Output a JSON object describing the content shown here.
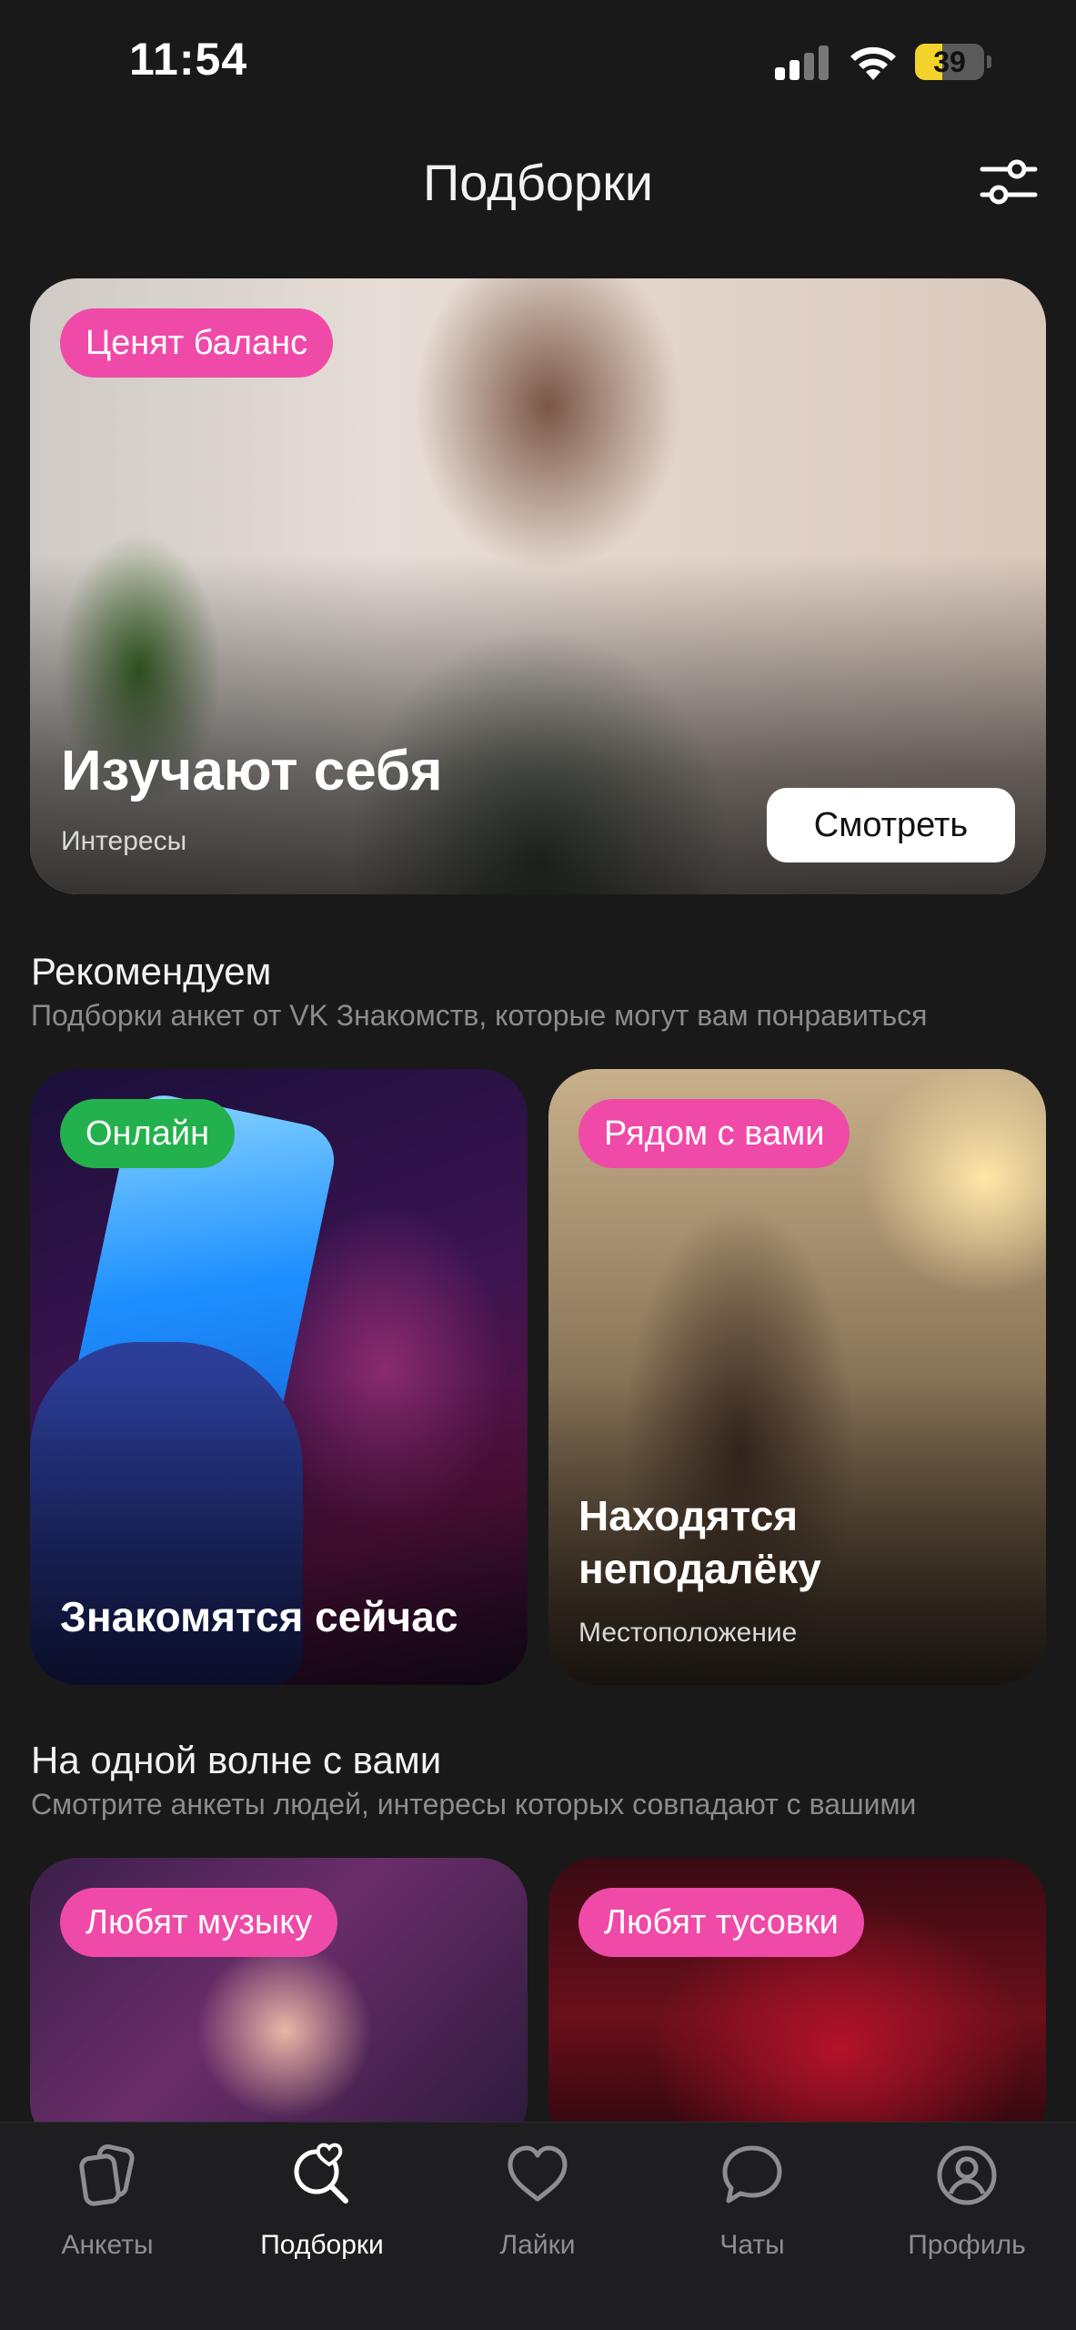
{
  "status_bar": {
    "time": "11:54",
    "battery": "39",
    "battery_level": 0.39,
    "battery_color": "#f3d32b"
  },
  "header": {
    "title": "Подборки",
    "filter_icon": "sliders-icon"
  },
  "hero": {
    "tag": "Ценят баланс",
    "title": "Изучают себя",
    "subtitle": "Интересы",
    "button": "Смотреть"
  },
  "sections": [
    {
      "title": "Рекомендуем",
      "subtitle": "Подборки анкет от VK Знакомств, которые могут вам понравиться",
      "cards": [
        {
          "tag": "Онлайн",
          "title": "Знакомятся сейчас",
          "subtitle": ""
        },
        {
          "tag": "Рядом с вами",
          "title": "Находятся неподалёку",
          "subtitle": "Местоположение"
        }
      ]
    },
    {
      "title": "На одной волне с вами",
      "subtitle": "Смотрите анкеты людей, интересы которых совпадают с вашими",
      "cards": [
        {
          "tag": "Любят музыку"
        },
        {
          "tag": "Любят тусовки"
        }
      ]
    }
  ],
  "tabbar": {
    "items": [
      {
        "label": "Анкеты",
        "icon": "cards-icon",
        "active": false
      },
      {
        "label": "Подборки",
        "icon": "heart-search-icon",
        "active": true
      },
      {
        "label": "Лайки",
        "icon": "heart-icon",
        "active": false
      },
      {
        "label": "Чаты",
        "icon": "chat-bubble-icon",
        "active": false
      },
      {
        "label": "Профиль",
        "icon": "profile-icon",
        "active": false
      }
    ]
  },
  "colors": {
    "background": "#19191a",
    "tag_pink": "#f04aa8",
    "tag_green": "#23b14d",
    "tabbar": "#1e1e20"
  }
}
